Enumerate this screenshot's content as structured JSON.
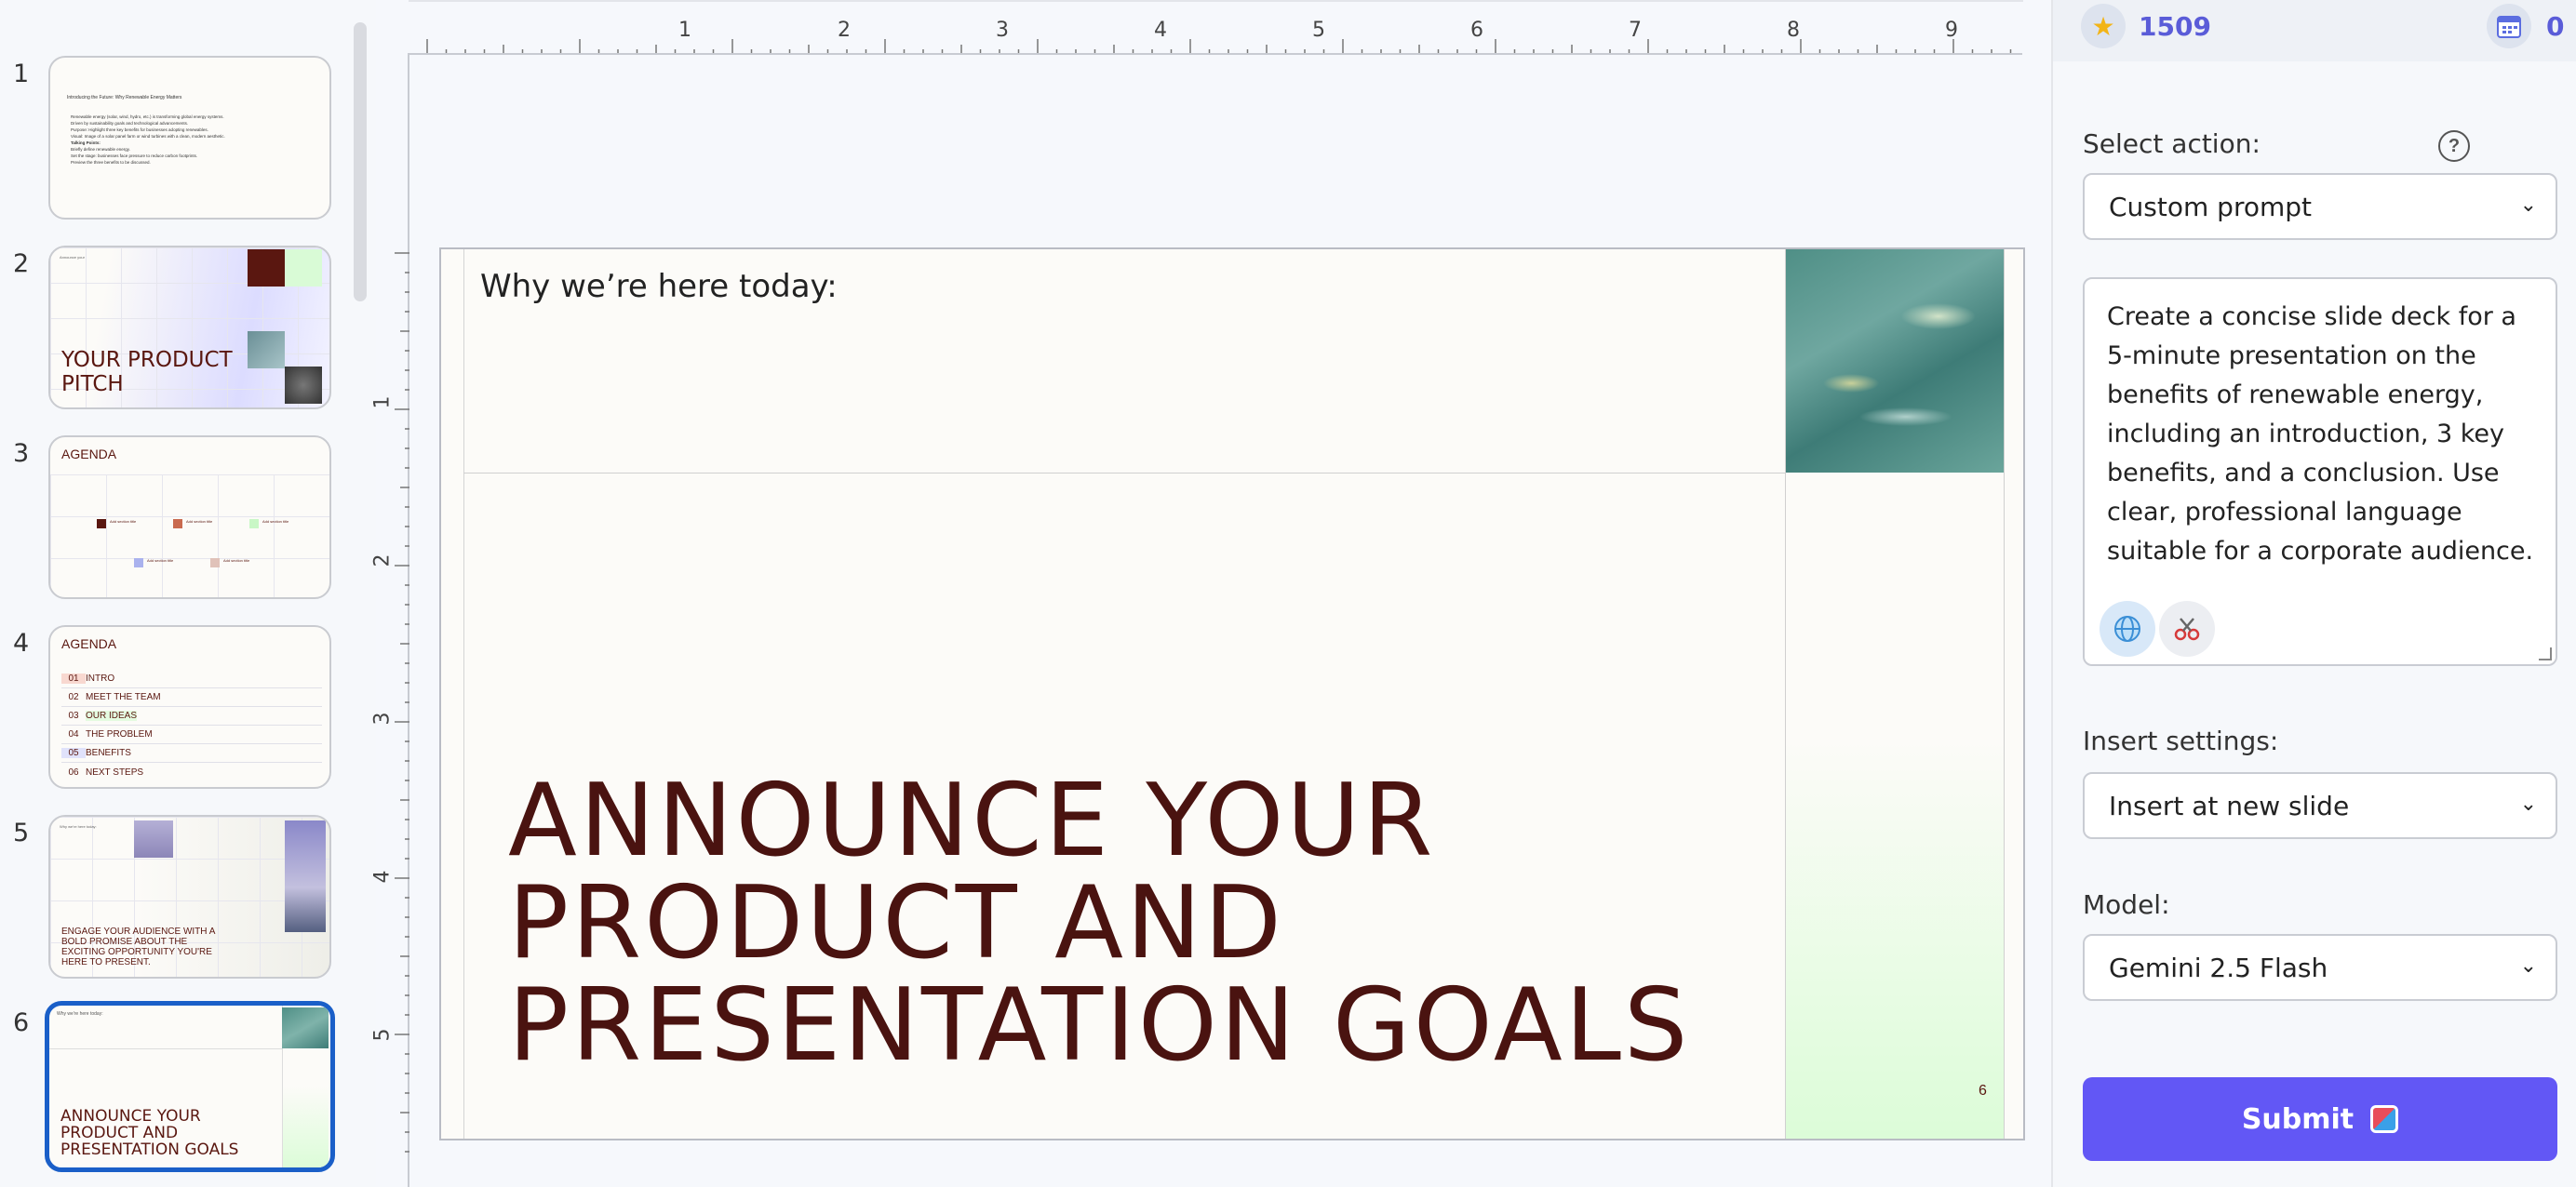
{
  "thumbnails": {
    "slides": [
      {
        "num": "1",
        "title": "Introducing the Future: Why Renewable Energy Matters",
        "bullets": [
          "Renewable energy (solar, wind, hydro, etc.) is transforming global energy systems.",
          "Driven by sustainability goals and technological advancements.",
          "Purpose: Highlight three key benefits for businesses adopting renewables.",
          "Visual: Image of a solar panel farm or wind turbines with a clean, modern aesthetic.",
          "Talking Points:",
          "Briefly define renewable energy.",
          "Set the stage: businesses face pressure to reduce carbon footprints.",
          "Preview the three benefits to be discussed."
        ]
      },
      {
        "num": "2",
        "label": "Announce your",
        "title": "YOUR PRODUCT PITCH"
      },
      {
        "num": "3",
        "title": "AGENDA",
        "items": [
          "Add section title",
          "Add section title",
          "Add section title",
          "Add section title",
          "Add section title"
        ]
      },
      {
        "num": "4",
        "title": "AGENDA",
        "rows": [
          {
            "n": "01",
            "t": "INTRO"
          },
          {
            "n": "02",
            "t": "MEET THE TEAM"
          },
          {
            "n": "03",
            "t": "OUR IDEAS"
          },
          {
            "n": "04",
            "t": "THE PROBLEM"
          },
          {
            "n": "05",
            "t": "BENEFITS"
          },
          {
            "n": "06",
            "t": "NEXT STEPS"
          }
        ]
      },
      {
        "num": "5",
        "label": "Why we're here today:",
        "title": "ENGAGE YOUR AUDIENCE WITH A BOLD PROMISE ABOUT THE EXCITING OPPORTUNITY YOU'RE HERE TO PRESENT."
      },
      {
        "num": "6",
        "label": "Why we're here today:",
        "title": "ANNOUNCE YOUR PRODUCT AND PRESENTATION GOALS"
      }
    ]
  },
  "ruler": {
    "horizontal": [
      "1",
      "2",
      "3",
      "4",
      "5",
      "6",
      "7",
      "8",
      "9"
    ],
    "vertical": [
      "1",
      "2",
      "3",
      "4",
      "5"
    ]
  },
  "slide": {
    "small_title": "Why we’re here today:",
    "big_title_lines": [
      "ANNOUNCE YOUR",
      "PRODUCT AND",
      "PRESENTATION GOALS"
    ],
    "page_number": "6"
  },
  "panel": {
    "stats": {
      "points": "1509",
      "calendar_count": "0"
    },
    "select_action_label": "Select action:",
    "help_symbol": "?",
    "action_value": "Custom prompt",
    "prompt_text": "Create a concise slide deck for a 5-minute presentation on the benefits of renewable energy, including an introduction, 3 key benefits, and a conclusion. Use clear, professional language suitable for a corporate audience.",
    "insert_settings_label": "Insert settings:",
    "insert_value": "Insert at new slide",
    "model_label": "Model:",
    "model_value": "Gemini 2.5 Flash",
    "submit_label": "Submit"
  },
  "colors": {
    "accent": "#6257f5",
    "title_maroon": "#4a1310",
    "active_border": "#1a5fc8"
  },
  "icons": [
    "star-icon",
    "calendar-icon",
    "help-icon",
    "globe-icon",
    "scissors-icon",
    "chevron-down-icon",
    "submit-icon"
  ]
}
